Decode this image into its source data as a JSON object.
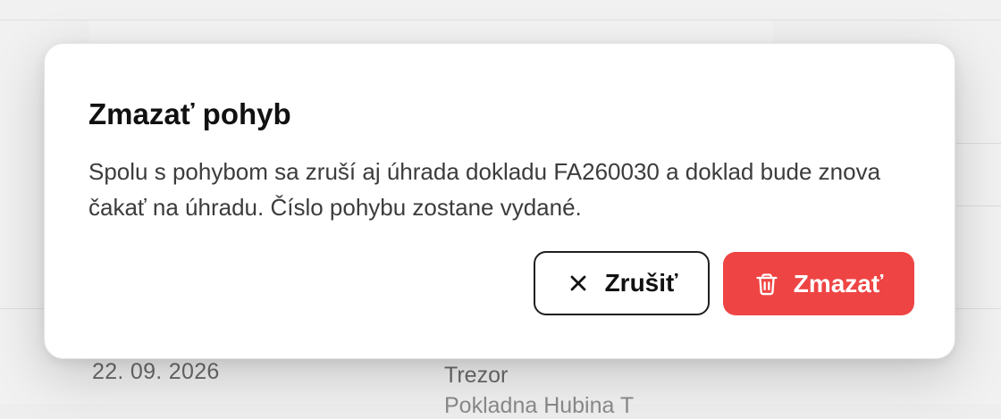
{
  "background": {
    "row_date": "22. 09. 2026",
    "row_account": "Trezor",
    "row_account_sub": "Pokladna Hubina T"
  },
  "dialog": {
    "title": "Zmazať pohyb",
    "message": "Spolu s pohybom sa zruší aj úhrada dokladu FA260030 a doklad bude znova čakať na úhradu. Číslo pohybu zostane vydané.",
    "cancel_label": "Zrušiť",
    "cancel_icon": "close-icon",
    "delete_label": "Zmazať",
    "delete_icon": "trash-icon",
    "delete_color": "#ef4444"
  }
}
